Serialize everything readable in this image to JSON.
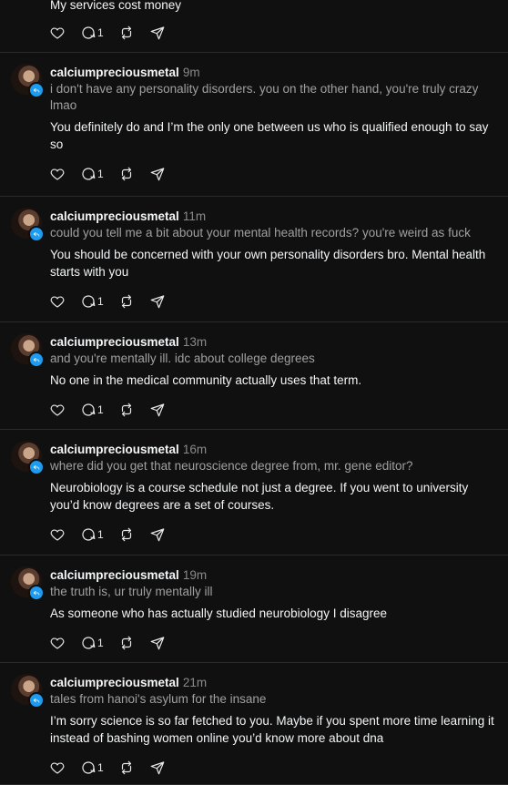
{
  "top": {
    "text": "My services cost money",
    "reply_count": "1"
  },
  "posts": [
    {
      "user": "calciumpreciousmetal",
      "time": "9m",
      "quoted": "i don't have any personality disorders. you on the other hand, you're truly crazy lmao",
      "body": "You definitely do and I’m the only one between us who is qualified enough to say so",
      "reply_count": "1"
    },
    {
      "user": "calciumpreciousmetal",
      "time": "11m",
      "quoted": "could you tell me a bit about your mental health records? you're weird as fuck",
      "body": "You should be concerned with your own personality disorders bro. Mental health starts with you",
      "reply_count": "1"
    },
    {
      "user": "calciumpreciousmetal",
      "time": "13m",
      "quoted": "and you're mentally ill. idc about college degrees",
      "body": "No one in the medical community actually uses that term.",
      "reply_count": "1"
    },
    {
      "user": "calciumpreciousmetal",
      "time": "16m",
      "quoted": "where did you get that neuroscience degree from, mr. gene editor?",
      "body": "Neurobiology is a course schedule not just a degree. If you went to university you’d know degrees are a set of courses.",
      "reply_count": "1"
    },
    {
      "user": "calciumpreciousmetal",
      "time": "19m",
      "quoted": "the truth is, ur truly mentally ill",
      "body": "As someone who has actually studied neurobiology I disagree",
      "reply_count": "1"
    },
    {
      "user": "calciumpreciousmetal",
      "time": "21m",
      "quoted": "tales from hanoi's asylum for the insane",
      "body": "I’m sorry science is so far fetched to you. Maybe if you spent more time learning it instead of bashing women online you’d know more about dna",
      "reply_count": "1"
    }
  ],
  "icons": {
    "like": "heart-icon",
    "reply": "comment-icon",
    "repost": "repost-icon",
    "share": "send-icon",
    "badge": "reply-arrow-icon"
  },
  "colors": {
    "background": "#101010",
    "text": "#f3f5f7",
    "secondary": "#8a8a8a",
    "badge": "#1d9bf0"
  }
}
